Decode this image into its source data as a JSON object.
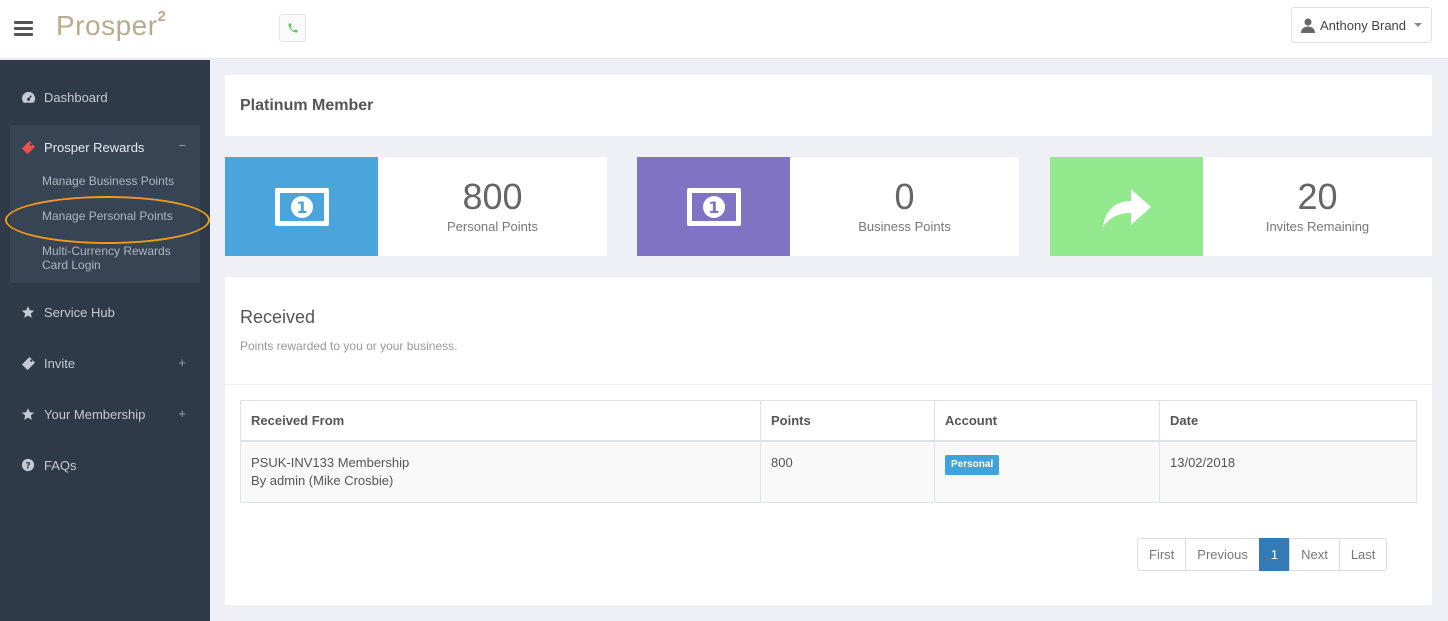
{
  "app": {
    "logo": "Prosper",
    "logo_sup": "2"
  },
  "header": {
    "user_name": "Anthony Brand"
  },
  "sidebar": {
    "dashboard": "Dashboard",
    "rewards": {
      "label": "Prosper Rewards",
      "toggle": "−",
      "items": [
        "Manage Business Points",
        "Manage Personal Points",
        "Multi-Currency Rewards Card Login"
      ]
    },
    "service_hub": "Service Hub",
    "invite": {
      "label": "Invite",
      "toggle": "+"
    },
    "membership": {
      "label": "Your Membership",
      "toggle": "+"
    },
    "faqs": "FAQs"
  },
  "member": {
    "title": "Platinum Member"
  },
  "stats": [
    {
      "value": "800",
      "label": "Personal Points",
      "color": "#4aa5dd"
    },
    {
      "value": "0",
      "label": "Business Points",
      "color": "#8073c4"
    },
    {
      "value": "20",
      "label": "Invites Remaining",
      "color": "#93e98d"
    }
  ],
  "received": {
    "title": "Received",
    "subtitle": "Points rewarded to you or your business.",
    "columns": [
      "Received From",
      "Points",
      "Account",
      "Date"
    ],
    "rows": [
      {
        "from_line1": "PSUK-INV133 Membership",
        "from_line2": "By admin (Mike Crosbie)",
        "points": "800",
        "account": "Personal",
        "date": "13/02/2018"
      }
    ]
  },
  "pagination": {
    "first": "First",
    "previous": "Previous",
    "current": "1",
    "next": "Next",
    "last": "Last"
  }
}
